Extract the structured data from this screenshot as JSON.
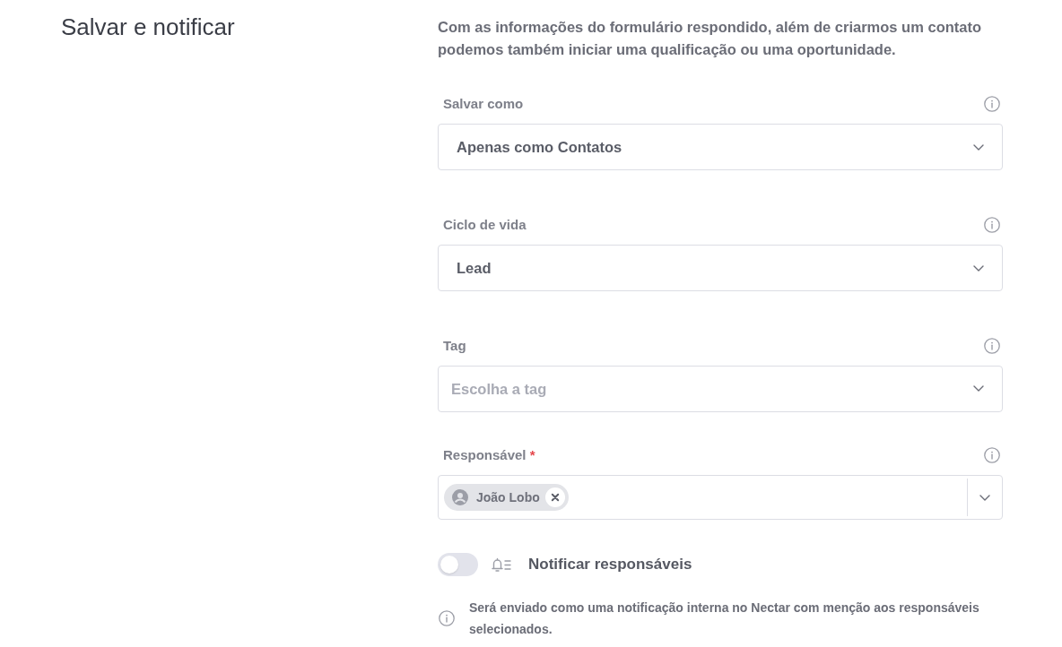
{
  "section": {
    "title": "Salvar e notificar",
    "description": "Com as informações do formulário respondido, além de criarmos um contato podemos também iniciar uma qualificação ou uma oportunidade."
  },
  "fields": [
    {
      "kind": "select",
      "label": "Salvar como",
      "value": "Apenas como Contatos"
    },
    {
      "kind": "select",
      "label": "Ciclo de vida",
      "value": "Lead"
    },
    {
      "kind": "select",
      "label": "Tag",
      "placeholder": "Escolha a tag"
    },
    {
      "kind": "multiselect",
      "label": "Responsável",
      "required_mark": "*",
      "chips": [
        {
          "label": "João Lobo"
        }
      ]
    }
  ],
  "notify": {
    "label": "Notificar responsáveis",
    "on": false
  },
  "note": "Será enviado como uma notificação interna no Nectar com menção aos responsáveis selecionados."
}
